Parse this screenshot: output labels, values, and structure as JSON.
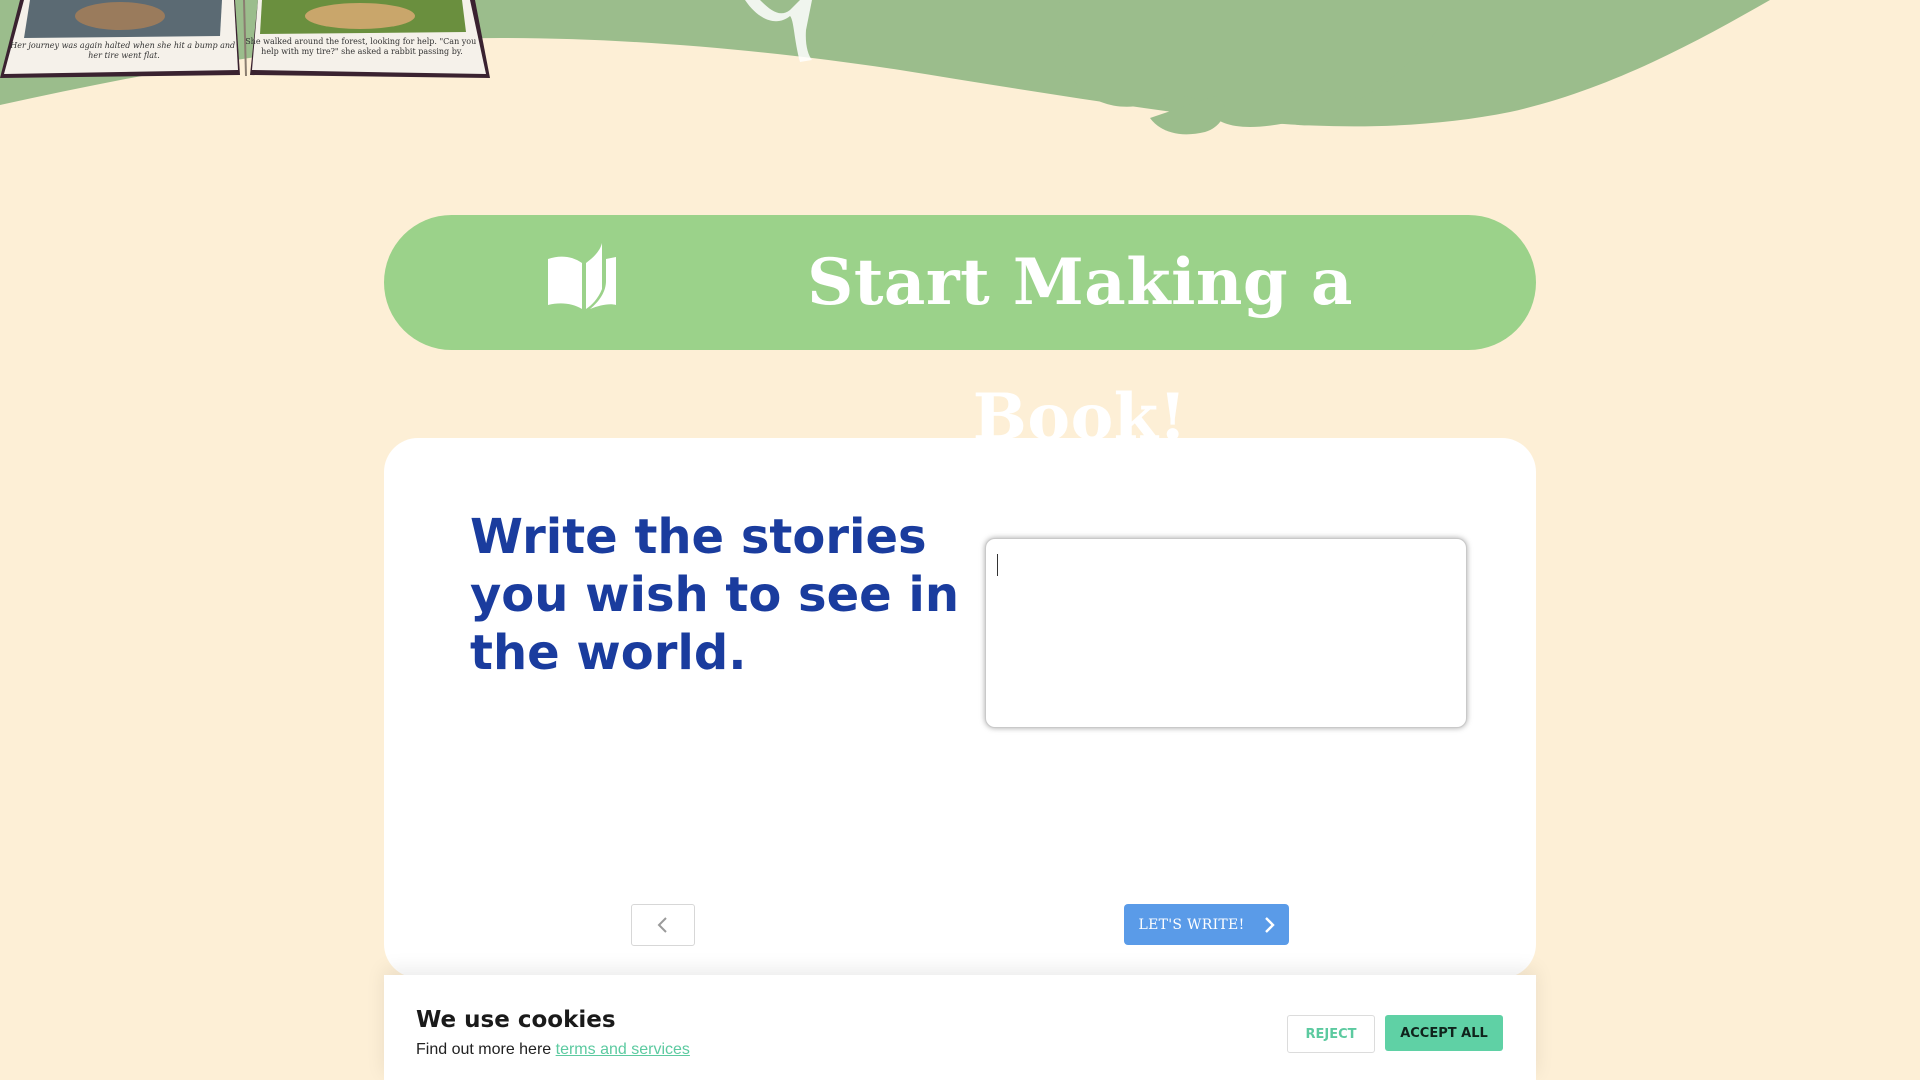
{
  "colors": {
    "page_background": "#fdefd6",
    "hero_green": "#9bbd8c",
    "banner_green": "#9bd28a",
    "headline_blue": "#1a3c9e",
    "button_blue": "#5a9be8",
    "accent_teal": "#5fd1a5"
  },
  "hero": {
    "book_photo": "open-picture-book-image",
    "book_left_page_text": "Her journey was again halted when she hit a bump and her tire went flat.",
    "book_right_page_text": "She walked around the forest, looking for help. \"Can you help with my tire?\" she asked a rabbit passing by."
  },
  "banner": {
    "icon": "open-book-icon",
    "label": "Start Making a Book!"
  },
  "card": {
    "headline": "Write the stories you wish to see in the world.",
    "story_input": {
      "value": "",
      "placeholder": ""
    },
    "prev_icon": "chevron-left-icon",
    "next_label": "LET'S WRITE!",
    "next_icon": "chevron-right-icon"
  },
  "cookies": {
    "title": "We use cookies",
    "text": "Find out more here",
    "link_text": "terms and services",
    "reject_label": "REJECT",
    "accept_label": "ACCEPT ALL"
  }
}
